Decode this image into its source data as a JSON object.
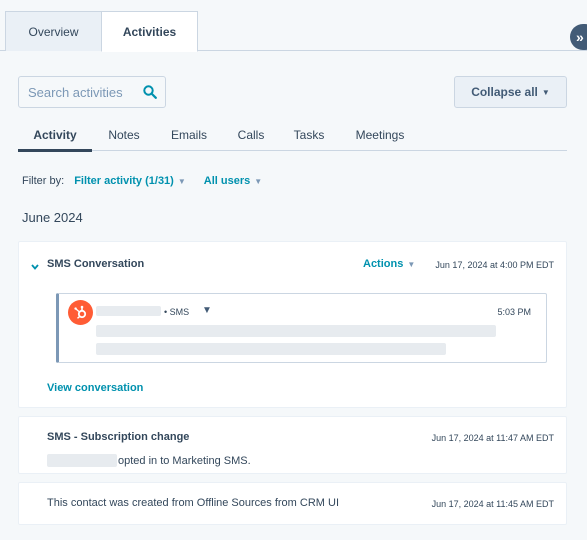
{
  "top_tabs": [
    {
      "label": "Overview",
      "active": false
    },
    {
      "label": "Activities",
      "active": true
    }
  ],
  "sidebar_toggle_icon": "double-chevron-right-icon",
  "search": {
    "placeholder": "Search activities",
    "icon": "search-icon"
  },
  "collapse_button": {
    "label": "Collapse all"
  },
  "sub_tabs": [
    {
      "label": "Activity",
      "active": true
    },
    {
      "label": "Notes",
      "active": false
    },
    {
      "label": "Emails",
      "active": false
    },
    {
      "label": "Calls",
      "active": false
    },
    {
      "label": "Tasks",
      "active": false
    },
    {
      "label": "Meetings",
      "active": false
    }
  ],
  "filter": {
    "label": "Filter by:",
    "activity": "Filter activity (1/31)",
    "users": "All users"
  },
  "month_header": "June 2024",
  "sms_card": {
    "title": "SMS Conversation",
    "actions_label": "Actions",
    "date": "Jun 17, 2024 at 4:00 PM EDT",
    "message": {
      "channel": "• SMS",
      "time": "5:03 PM",
      "logo_icon": "hubspot-sprocket-icon"
    },
    "view_link": "View conversation"
  },
  "subscription_card": {
    "title": "SMS - Subscription change",
    "date": "Jun 17, 2024 at 11:47 AM EDT",
    "text": "opted in to Marketing SMS."
  },
  "created_card": {
    "text": "This contact was created from Offline Sources from CRM UI",
    "date": "Jun 17, 2024 at 11:45 AM EDT"
  },
  "colors": {
    "accent": "#0091ae",
    "hubspot_orange": "#ff5c35",
    "text": "#33475b",
    "border": "#cbd6e2",
    "background": "#f5f8fa"
  }
}
